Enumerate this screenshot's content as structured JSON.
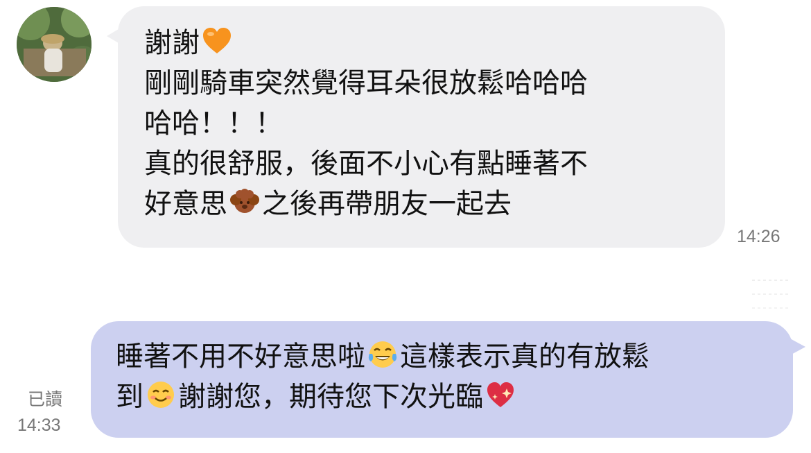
{
  "contact": {
    "avatar_icon": "contact-avatar-photo"
  },
  "messages": {
    "incoming": {
      "lines": [
        "謝謝",
        "剛剛騎車突然覺得耳朵很放鬆哈哈哈",
        "哈哈！！！",
        "真的很舒服，後面不小心有點睡著不",
        "好意思",
        "之後再帶朋友一起去"
      ],
      "emojis": [
        "orange-heart-icon",
        "brown-poodle-dog-icon"
      ],
      "time": "14:26"
    },
    "outgoing": {
      "lines": [
        "睡著不用不好意思啦",
        "這樣表示真的有放鬆",
        "到",
        "謝謝您，期待您下次光臨"
      ],
      "emojis": [
        "tears-of-joy-icon",
        "smiling-blush-icon",
        "sparkling-heart-icon"
      ],
      "read_label": "已讀",
      "time": "14:33"
    }
  },
  "colors": {
    "incoming_bubble": "#efeff1",
    "outgoing_bubble": "#ccd0f0",
    "timestamp": "#777777"
  }
}
